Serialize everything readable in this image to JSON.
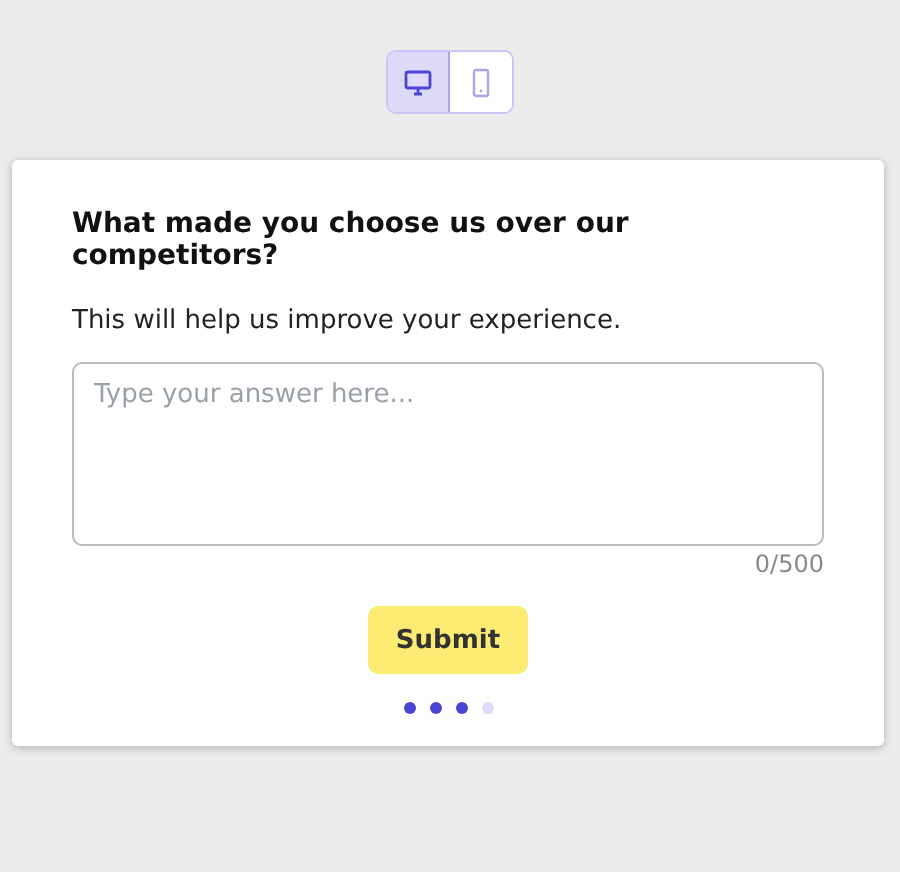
{
  "view_toggle": [
    {
      "kind": "desktop",
      "selected": true
    },
    {
      "kind": "mobile",
      "selected": false
    }
  ],
  "survey": {
    "question": "What made you choose us over our competitors?",
    "description": "This will help us improve your experience.",
    "answer": {
      "placeholder": "Type your answer here..."
    },
    "counter": "0/500",
    "submit": "Submit",
    "steps": [
      {
        "done": true
      },
      {
        "done": true
      },
      {
        "done": true
      },
      {
        "done": false
      }
    ]
  }
}
